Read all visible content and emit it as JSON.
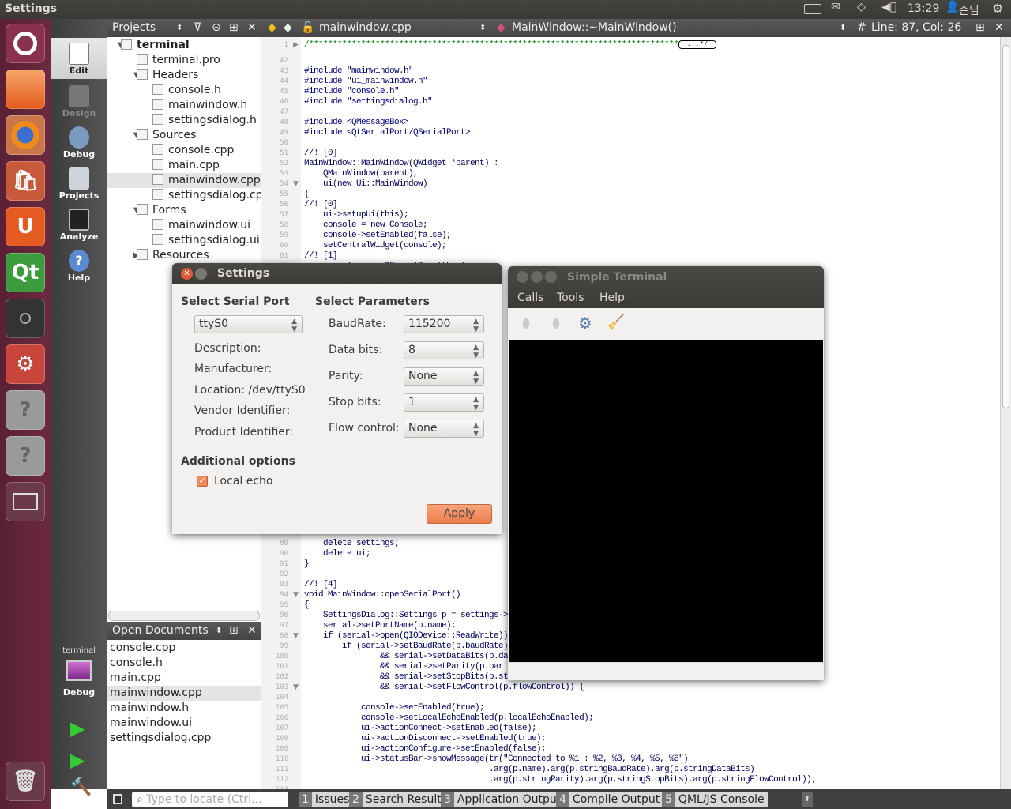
{
  "topbar": {
    "title": "Settings",
    "clock": "13:29",
    "user": "손님",
    "icons": [
      "keyboard-icon",
      "mail-icon",
      "wifi-icon",
      "volume-icon",
      "user-icon",
      "power-gear-icon"
    ]
  },
  "launcher": [
    "ubuntu-dash-icon",
    "files-icon",
    "firefox-icon",
    "software-center-icon",
    "ubuntu-one-icon",
    "qt-creator-icon",
    "camera-icon",
    "system-settings-icon",
    "unknown-app-icon",
    "unknown-app-icon",
    "workspace-switcher-icon",
    "trash-icon"
  ],
  "modes": [
    {
      "label": "Edit"
    },
    {
      "label": "Design"
    },
    {
      "label": "Debug"
    },
    {
      "label": "Projects"
    },
    {
      "label": "Analyze"
    },
    {
      "label": "Help"
    }
  ],
  "kit": {
    "project": "terminal",
    "mode": "Debug"
  },
  "projects": {
    "title": "Projects",
    "tree": [
      {
        "label": "terminal",
        "level": 0,
        "arrow": "down",
        "bold": true
      },
      {
        "label": "terminal.pro",
        "level": 1
      },
      {
        "label": "Headers",
        "level": 1,
        "arrow": "down"
      },
      {
        "label": "console.h",
        "level": 2
      },
      {
        "label": "mainwindow.h",
        "level": 2
      },
      {
        "label": "settingsdialog.h",
        "level": 2
      },
      {
        "label": "Sources",
        "level": 1,
        "arrow": "down"
      },
      {
        "label": "console.cpp",
        "level": 2
      },
      {
        "label": "main.cpp",
        "level": 2
      },
      {
        "label": "mainwindow.cpp",
        "level": 2,
        "selected": true
      },
      {
        "label": "settingsdialog.cpp",
        "level": 2
      },
      {
        "label": "Forms",
        "level": 1,
        "arrow": "down"
      },
      {
        "label": "mainwindow.ui",
        "level": 2
      },
      {
        "label": "settingsdialog.ui",
        "level": 2
      },
      {
        "label": "Resources",
        "level": 1,
        "arrow": "right"
      }
    ]
  },
  "open_documents": {
    "title": "Open Documents",
    "items": [
      "console.cpp",
      "console.h",
      "main.cpp",
      "mainwindow.cpp",
      "mainwindow.h",
      "mainwindow.ui",
      "settingsdialog.cpp"
    ],
    "selected": 3
  },
  "editor": {
    "file": "mainwindow.cpp",
    "symbol": "MainWindow::~MainWindow()",
    "hash": "#",
    "position": "Line: 87, Col: 26",
    "fold_marker": "...*/",
    "lines": [
      {
        "n": "1",
        "t": "/******************************************************************************",
        "c": "cm",
        "fold": "▶"
      },
      {
        "n": "42",
        "t": ""
      },
      {
        "n": "43",
        "t": "#include \"mainwindow.h\"",
        "c": "pp"
      },
      {
        "n": "44",
        "t": "#include \"ui_mainwindow.h\"",
        "c": "pp"
      },
      {
        "n": "45",
        "t": "#include \"console.h\"",
        "c": "pp"
      },
      {
        "n": "46",
        "t": "#include \"settingsdialog.h\"",
        "c": "pp"
      },
      {
        "n": "47",
        "t": ""
      },
      {
        "n": "48",
        "t": "#include <QMessageBox>",
        "c": "pp"
      },
      {
        "n": "49",
        "t": "#include <QtSerialPort/QSerialPort>",
        "c": "pp"
      },
      {
        "n": "50",
        "t": ""
      },
      {
        "n": "51",
        "t": "//! [0]"
      },
      {
        "n": "52",
        "t": "MainWindow::MainWindow(QWidget *parent) :"
      },
      {
        "n": "53",
        "t": "    QMainWindow(parent),"
      },
      {
        "n": "54",
        "t": "    ui(new Ui::MainWindow)",
        "fold": "▼"
      },
      {
        "n": "55",
        "t": "{"
      },
      {
        "n": "56",
        "t": "//! [0]"
      },
      {
        "n": "57",
        "t": "    ui->setupUi(this);"
      },
      {
        "n": "58",
        "t": "    console = new Console;"
      },
      {
        "n": "59",
        "t": "    console->setEnabled(false);"
      },
      {
        "n": "60",
        "t": "    setCentralWidget(console);"
      },
      {
        "n": "61",
        "t": "//! [1]"
      },
      {
        "n": "62",
        "t": "    serial = new QSerialPort(this);"
      },
      {
        "n": "89",
        "t": "    delete settings;"
      },
      {
        "n": "90",
        "t": "    delete ui;"
      },
      {
        "n": "91",
        "t": "}"
      },
      {
        "n": "92",
        "t": ""
      },
      {
        "n": "93",
        "t": "//! [4]"
      },
      {
        "n": "94",
        "t": "void MainWindow::openSerialPort()",
        "fold": "▼"
      },
      {
        "n": "95",
        "t": "{"
      },
      {
        "n": "96",
        "t": "    SettingsDialog::Settings p = settings->"
      },
      {
        "n": "97",
        "t": "    serial->setPortName(p.name);"
      },
      {
        "n": "98",
        "t": "    if (serial->open(QIODevice::ReadWrite))",
        "fold": "▼"
      },
      {
        "n": "99",
        "t": "        if (serial->setBaudRate(p.baudRate)"
      },
      {
        "n": "100",
        "t": "                && serial->setDataBits(p.da"
      },
      {
        "n": "101",
        "t": "                && serial->setParity(p.pari"
      },
      {
        "n": "102",
        "t": "                && serial->setStopBits(p.st"
      },
      {
        "n": "103",
        "t": "                && serial->setFlowControl(p.flowControl)) {",
        "fold": "▼"
      },
      {
        "n": "104",
        "t": ""
      },
      {
        "n": "105",
        "t": "            console->setEnabled(true);"
      },
      {
        "n": "106",
        "t": "            console->setLocalEchoEnabled(p.localEchoEnabled);"
      },
      {
        "n": "107",
        "t": "            ui->actionConnect->setEnabled(false);"
      },
      {
        "n": "108",
        "t": "            ui->actionDisconnect->setEnabled(true);"
      },
      {
        "n": "109",
        "t": "            ui->actionConfigure->setEnabled(false);"
      },
      {
        "n": "110",
        "t": "            ui->statusBar->showMessage(tr(\"Connected to %1 : %2, %3, %4, %5, %6\")"
      },
      {
        "n": "111",
        "t": "                                       .arg(p.name).arg(p.stringBaudRate).arg(p.stringDataBits)"
      },
      {
        "n": "112",
        "t": "                                       .arg(p.stringParity).arg(p.stringStopBits).arg(p.stringFlowControl));"
      },
      {
        "n": "113",
        "t": ""
      }
    ]
  },
  "bottombar": {
    "locator_placeholder": "Type to locate (Ctrl...",
    "tabs": [
      {
        "num": "1",
        "label": "Issues"
      },
      {
        "num": "2",
        "label": "Search Results"
      },
      {
        "num": "3",
        "label": "Application Output"
      },
      {
        "num": "4",
        "label": "Compile Output"
      },
      {
        "num": "5",
        "label": "QML/JS Console"
      }
    ]
  },
  "settings_dialog": {
    "title": "Settings",
    "serial_port": {
      "heading": "Select Serial Port",
      "port": "ttyS0",
      "description": "Description:",
      "manufacturer": "Manufacturer:",
      "location": "Location: /dev/ttyS0",
      "vendor": "Vendor Identifier:",
      "product": "Product Identifier:"
    },
    "parameters": {
      "heading": "Select Parameters",
      "rows": [
        {
          "label": "BaudRate:",
          "value": "115200"
        },
        {
          "label": "Data bits:",
          "value": "8"
        },
        {
          "label": "Parity:",
          "value": "None"
        },
        {
          "label": "Stop bits:",
          "value": "1"
        },
        {
          "label": "Flow control:",
          "value": "None"
        }
      ]
    },
    "additional": {
      "heading": "Additional options",
      "local_echo": "Local echo",
      "local_echo_checked": true
    },
    "apply": "Apply",
    "accent": "#f08a5d"
  },
  "terminal_window": {
    "title": "Simple Terminal",
    "menu": [
      "Calls",
      "Tools",
      "Help"
    ],
    "toolbar": [
      "connect-icon",
      "disconnect-icon",
      "configure-gear-icon",
      "clear-broom-icon"
    ]
  }
}
